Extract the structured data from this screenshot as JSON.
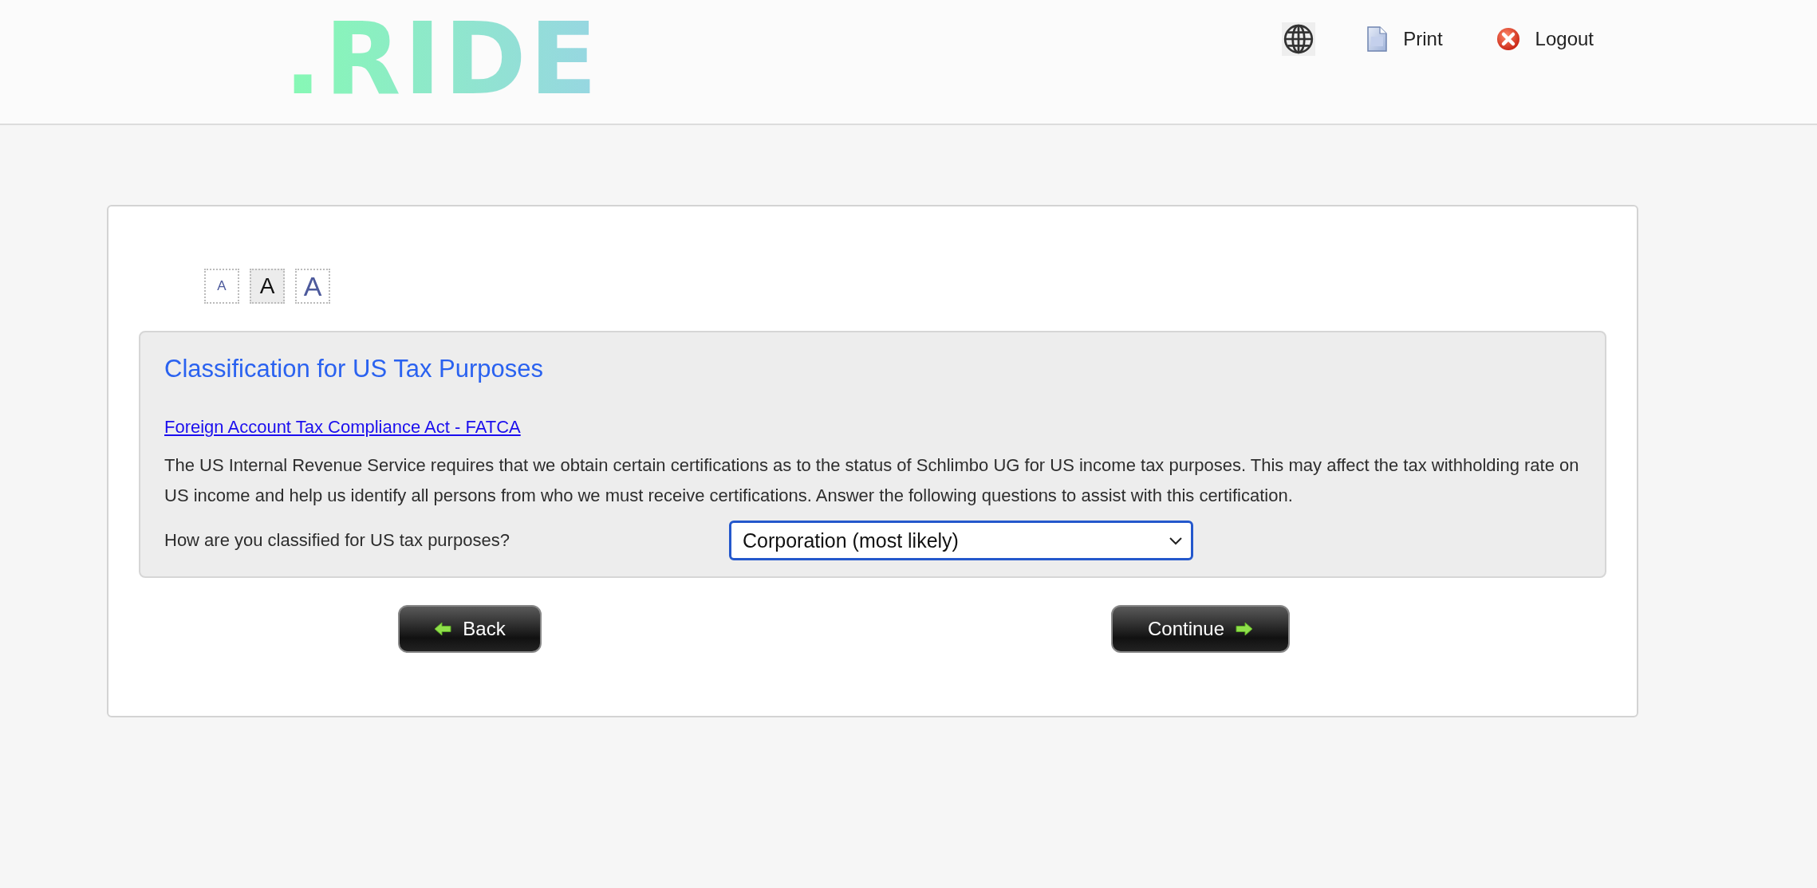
{
  "header": {
    "logo": ".RIDE",
    "links": [
      {
        "kind": "print",
        "label": "Print"
      },
      {
        "kind": "logout",
        "label": "Logout"
      }
    ]
  },
  "font_sizes": [
    {
      "kind": "small",
      "label": "A",
      "selected": false
    },
    {
      "kind": "medium",
      "label": "A",
      "selected": true
    },
    {
      "kind": "large",
      "label": "A",
      "selected": false
    }
  ],
  "section": {
    "title": "Classification for US Tax Purposes",
    "link": "Foreign Account Tax Compliance Act - FATCA",
    "description": "The US Internal Revenue Service requires that we obtain certain certifications as to the status of Schlimbo UG for US income tax purposes. This may affect the tax withholding rate on US income and help us identify all persons from who we must receive certifications. Answer the following questions to assist with this certification.",
    "question": {
      "label": "How are you classified for US tax purposes?",
      "value": "Corporation (most likely)"
    }
  },
  "buttons": [
    {
      "kind": "back",
      "label": "Back"
    },
    {
      "kind": "continue",
      "label": "Continue"
    }
  ]
}
